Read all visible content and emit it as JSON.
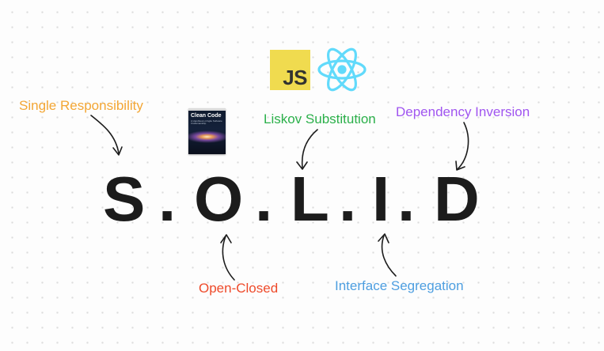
{
  "logos": {
    "js_text": "JS",
    "book_title": "Clean Code",
    "book_subtitle": "A Handbook of Agile Software Craftsmanship"
  },
  "principles": {
    "single_responsibility": "Single Responsibility",
    "open_closed": "Open-Closed",
    "liskov_substitution": "Liskov Substitution",
    "interface_segregation": "Interface Segregation",
    "dependency_inversion": "Dependency Inversion"
  },
  "acronym": {
    "s": "S",
    "o": "O",
    "l": "L",
    "i": "I",
    "d": "D",
    "dot": "."
  },
  "colors": {
    "single_responsibility": "#f3a634",
    "open_closed": "#ee4a2a",
    "liskov_substitution": "#2bb04a",
    "interface_segregation": "#4d9ee0",
    "dependency_inversion": "#a055f0",
    "js_logo": "#f0db4f",
    "react_logo": "#61dafb"
  },
  "icons": [
    "javascript-logo",
    "react-logo",
    "clean-code-book"
  ]
}
